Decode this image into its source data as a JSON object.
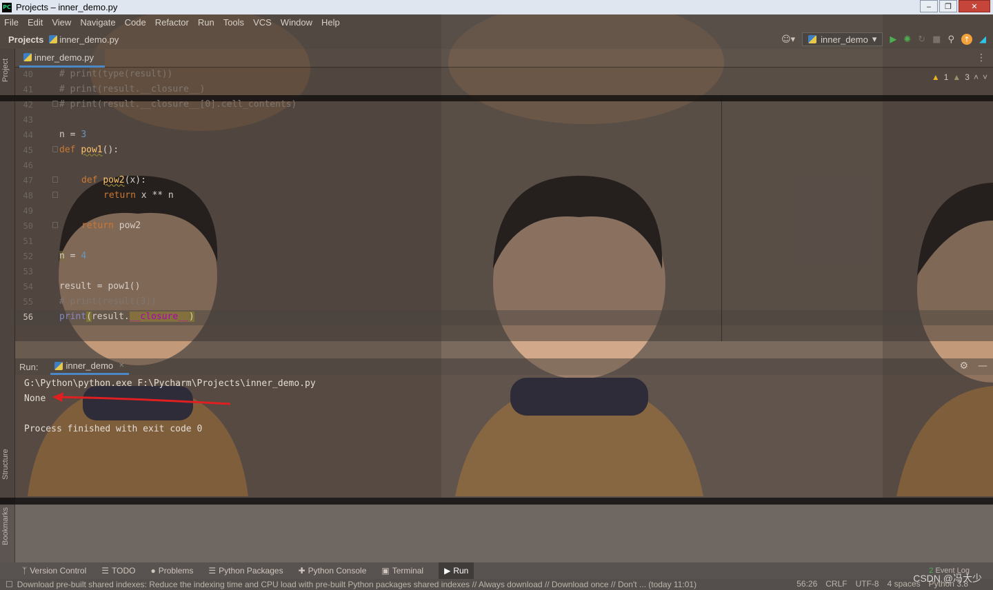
{
  "window": {
    "title": "Projects – inner_demo.py",
    "app_icon_text": "PC",
    "buttons": {
      "minimize": "‒",
      "maximize": "❐",
      "close": "✕"
    }
  },
  "menu": [
    "File",
    "Edit",
    "View",
    "Navigate",
    "Code",
    "Refactor",
    "Run",
    "Tools",
    "VCS",
    "Window",
    "Help"
  ],
  "navbar": {
    "project": "Projects",
    "file": "inner_demo.py",
    "run_config": "inner_demo"
  },
  "left_strip": {
    "project": "Project",
    "structure": "Structure",
    "bookmarks": "Bookmarks"
  },
  "editor": {
    "tab": "inner_demo.py",
    "inspections": {
      "warnings": "1",
      "weak_warnings": "3"
    },
    "line_numbers": [
      "40",
      "41",
      "42",
      "43",
      "44",
      "45",
      "46",
      "47",
      "48",
      "49",
      "50",
      "51",
      "52",
      "53",
      "54",
      "55",
      "56"
    ],
    "lines": {
      "l40": "# print(type(result))",
      "l41": "# print(result.__closure__)",
      "l42": "# print(result.__closure__[0].cell_contents)",
      "l44_a": "n = ",
      "l44_b": "3",
      "l45_kw": "def ",
      "l45_fn": "pow1",
      "l45_rest": "():",
      "l47_kw": "def ",
      "l47_fn": "pow2",
      "l47_rest": "(x):",
      "l48_kw": "return ",
      "l48_rest": "x ** n",
      "l50_kw": "return ",
      "l50_rest": "pow2",
      "l52_a": "n",
      "l52_b": " = ",
      "l52_c": "4",
      "l54": "result = pow1()",
      "l55": "# print(result(3))",
      "l56_builtin": "print",
      "l56_paren": "(",
      "l56_mid": "result.",
      "l56_magic": "__closure__",
      "l56_close": ")"
    }
  },
  "run": {
    "label": "Run:",
    "tab": "inner_demo",
    "output": [
      "G:\\Python\\python.exe F:\\Pycharm\\Projects\\inner_demo.py",
      "None",
      "",
      "Process finished with exit code 0"
    ]
  },
  "tool_windows": [
    "Version Control",
    "TODO",
    "Problems",
    "Python Packages",
    "Python Console",
    "Terminal",
    "Run"
  ],
  "event_log": {
    "count": "2",
    "label": "Event Log"
  },
  "status": {
    "message": "Download pre-built shared indexes: Reduce the indexing time and CPU load with pre-built Python packages shared indexes // Always download // Download once // Don't ... (today 11:01)",
    "position": "56:26",
    "line_ending": "CRLF",
    "encoding": "UTF-8",
    "indent": "4 spaces",
    "interpreter": "Python 3.8"
  },
  "watermark": "CSDN @冯大少",
  "colors": {
    "accent": "#4a88c7",
    "annotation_arrow": "#e02020",
    "keyword": "#cc7832",
    "function": "#ffc66d",
    "number": "#6897bb"
  }
}
